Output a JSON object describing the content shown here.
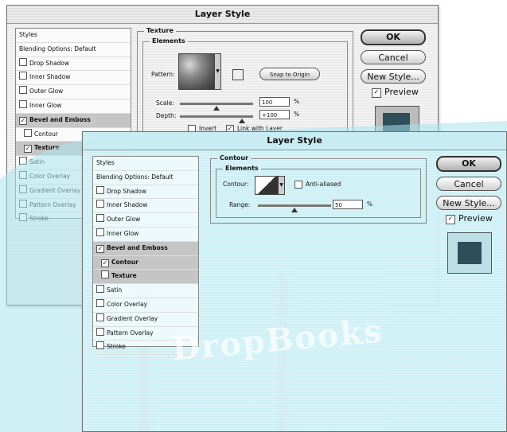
{
  "back_window": {
    "title": "Layer Style",
    "styles_list": [
      {
        "label": "Styles",
        "type": "header"
      },
      {
        "label": "Blending Options: Default",
        "type": "header"
      },
      {
        "label": "Drop Shadow",
        "checked": false
      },
      {
        "label": "Inner Shadow",
        "checked": false
      },
      {
        "label": "Outer Glow",
        "checked": false
      },
      {
        "label": "Inner Glow",
        "checked": false
      },
      {
        "label": "Bevel and Emboss",
        "checked": true,
        "selected": true,
        "bold": true
      },
      {
        "label": "Contour",
        "checked": false,
        "sub": true
      },
      {
        "label": "Texture",
        "checked": true,
        "sub": true,
        "selected": true,
        "bold": true
      },
      {
        "label": "Satin",
        "checked": false
      },
      {
        "label": "Color Overlay",
        "checked": false
      },
      {
        "label": "Gradient Overlay",
        "checked": false
      },
      {
        "label": "Pattern Overlay",
        "checked": false
      },
      {
        "label": "Stroke",
        "checked": false
      }
    ],
    "panel_title": "Texture",
    "elements_title": "Elements",
    "pattern_label": "Pattern:",
    "snap_button": "Snap to Origin",
    "scale_label": "Scale:",
    "scale_value": "100",
    "scale_unit": "%",
    "scale_level": 0.5,
    "depth_label": "Depth:",
    "depth_value": "+100",
    "depth_unit": "%",
    "depth_level": 0.85,
    "invert_label": "Invert",
    "invert_checked": false,
    "link_label": "Link with Layer",
    "link_checked": true,
    "buttons": {
      "ok": "OK",
      "cancel": "Cancel",
      "new_style": "New Style..."
    },
    "preview_label": "Preview",
    "preview_checked": true
  },
  "front_window": {
    "title": "Layer Style",
    "styles_list": [
      {
        "label": "Styles",
        "type": "header"
      },
      {
        "label": "Blending Options: Default",
        "type": "header"
      },
      {
        "label": "Drop Shadow",
        "checked": false
      },
      {
        "label": "Inner Shadow",
        "checked": false
      },
      {
        "label": "Outer Glow",
        "checked": false
      },
      {
        "label": "Inner Glow",
        "checked": false
      },
      {
        "label": "Bevel and Emboss",
        "checked": true,
        "selected": true,
        "bold": true
      },
      {
        "label": "Contour",
        "checked": true,
        "sub": true,
        "selected": true,
        "bold": true
      },
      {
        "label": "Texture",
        "checked": false,
        "sub": true,
        "selected": true
      },
      {
        "label": "Satin",
        "checked": false
      },
      {
        "label": "Color Overlay",
        "checked": false
      },
      {
        "label": "Gradient Overlay",
        "checked": false
      },
      {
        "label": "Pattern Overlay",
        "checked": false
      },
      {
        "label": "Stroke",
        "checked": false
      }
    ],
    "panel_title": "Contour",
    "elements_title": "Elements",
    "contour_label": "Contour:",
    "antialiased_label": "Anti-aliased",
    "antialiased_checked": false,
    "range_label": "Range:",
    "range_value": "50",
    "range_unit": "%",
    "range_level": 0.5,
    "buttons": {
      "ok": "OK",
      "cancel": "Cancel",
      "new_style": "New Style..."
    },
    "preview_label": "Preview",
    "preview_checked": true
  },
  "watermark": {
    "text": "DropBooks"
  },
  "colors": {
    "overlay": "#a9e3ee",
    "preview_swatch": "#2e4f5a",
    "book_accent": "#e6a0b0"
  }
}
